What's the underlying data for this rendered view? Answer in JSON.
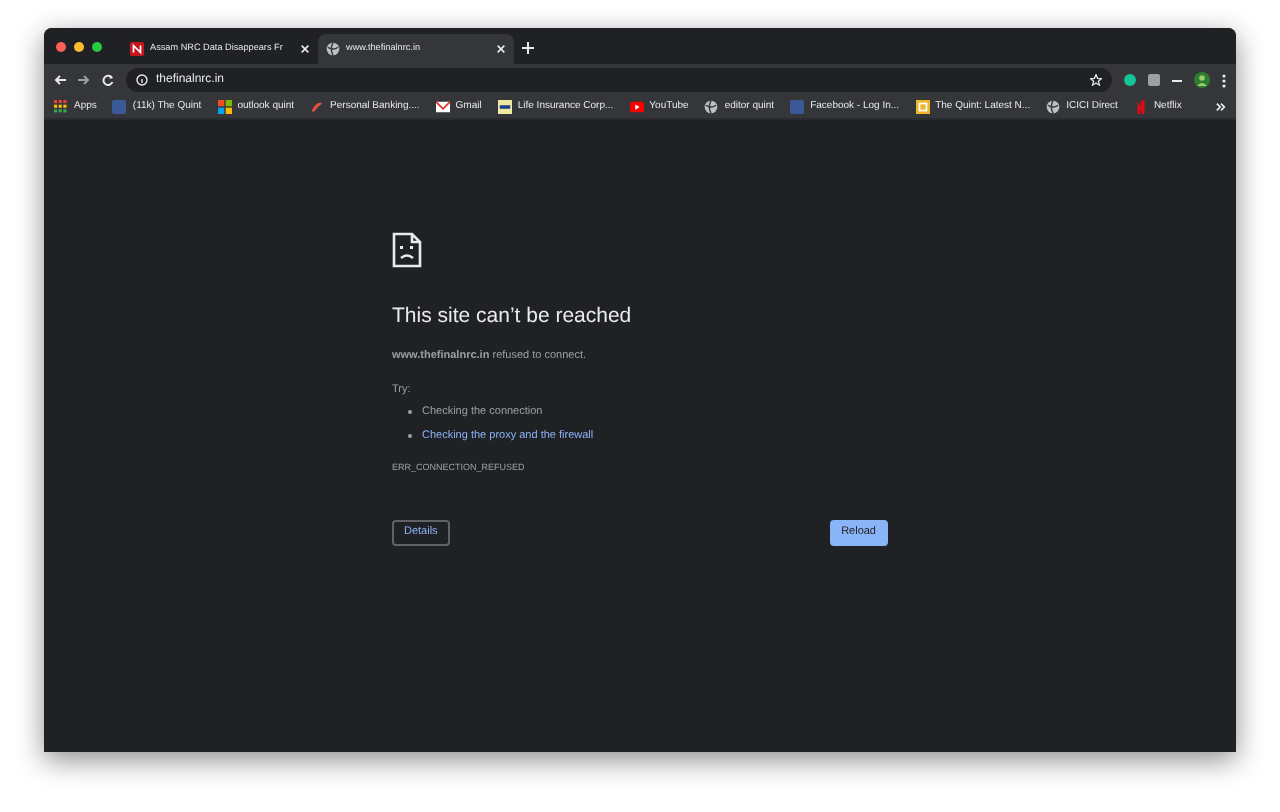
{
  "tabs": [
    {
      "title": "Assam NRC Data Disappears Fr",
      "kind": "quint",
      "selected": false
    },
    {
      "title": "www.thefinalnrc.in",
      "kind": "globe",
      "selected": true
    }
  ],
  "address_bar": {
    "value": "thefinalnrc.in"
  },
  "bookmarks": [
    {
      "label": "Apps",
      "kind": "grid"
    },
    {
      "label": "(11k) The Quint",
      "kind": "facebook"
    },
    {
      "label": "outlook quint",
      "kind": "windows"
    },
    {
      "label": "Personal Banking....",
      "kind": "bank"
    },
    {
      "label": "Gmail",
      "kind": "gmail"
    },
    {
      "label": "Life Insurance Corp...",
      "kind": "lic"
    },
    {
      "label": "YouTube",
      "kind": "youtube"
    },
    {
      "label": "editor quint",
      "kind": "globe"
    },
    {
      "label": "Facebook - Log In...",
      "kind": "facebook"
    },
    {
      "label": "The Quint: Latest N...",
      "kind": "quintsq"
    },
    {
      "label": "ICICI Direct",
      "kind": "globe"
    },
    {
      "label": "Netflix",
      "kind": "netflix"
    }
  ],
  "error": {
    "title": "This site can’t be reached",
    "message": "**www.thefinalnrc.in** refused to connect.",
    "try_label": "Try:",
    "suggestions": [
      {
        "text": "Checking the connection",
        "kind": "text"
      },
      {
        "text": "Checking the proxy and the firewall",
        "kind": "link"
      }
    ],
    "code": "ERR_CONNECTION_REFUSED"
  },
  "buttons": [
    {
      "label": "Details",
      "kind": "secondary"
    },
    {
      "label": "Reload",
      "kind": "primary"
    }
  ]
}
